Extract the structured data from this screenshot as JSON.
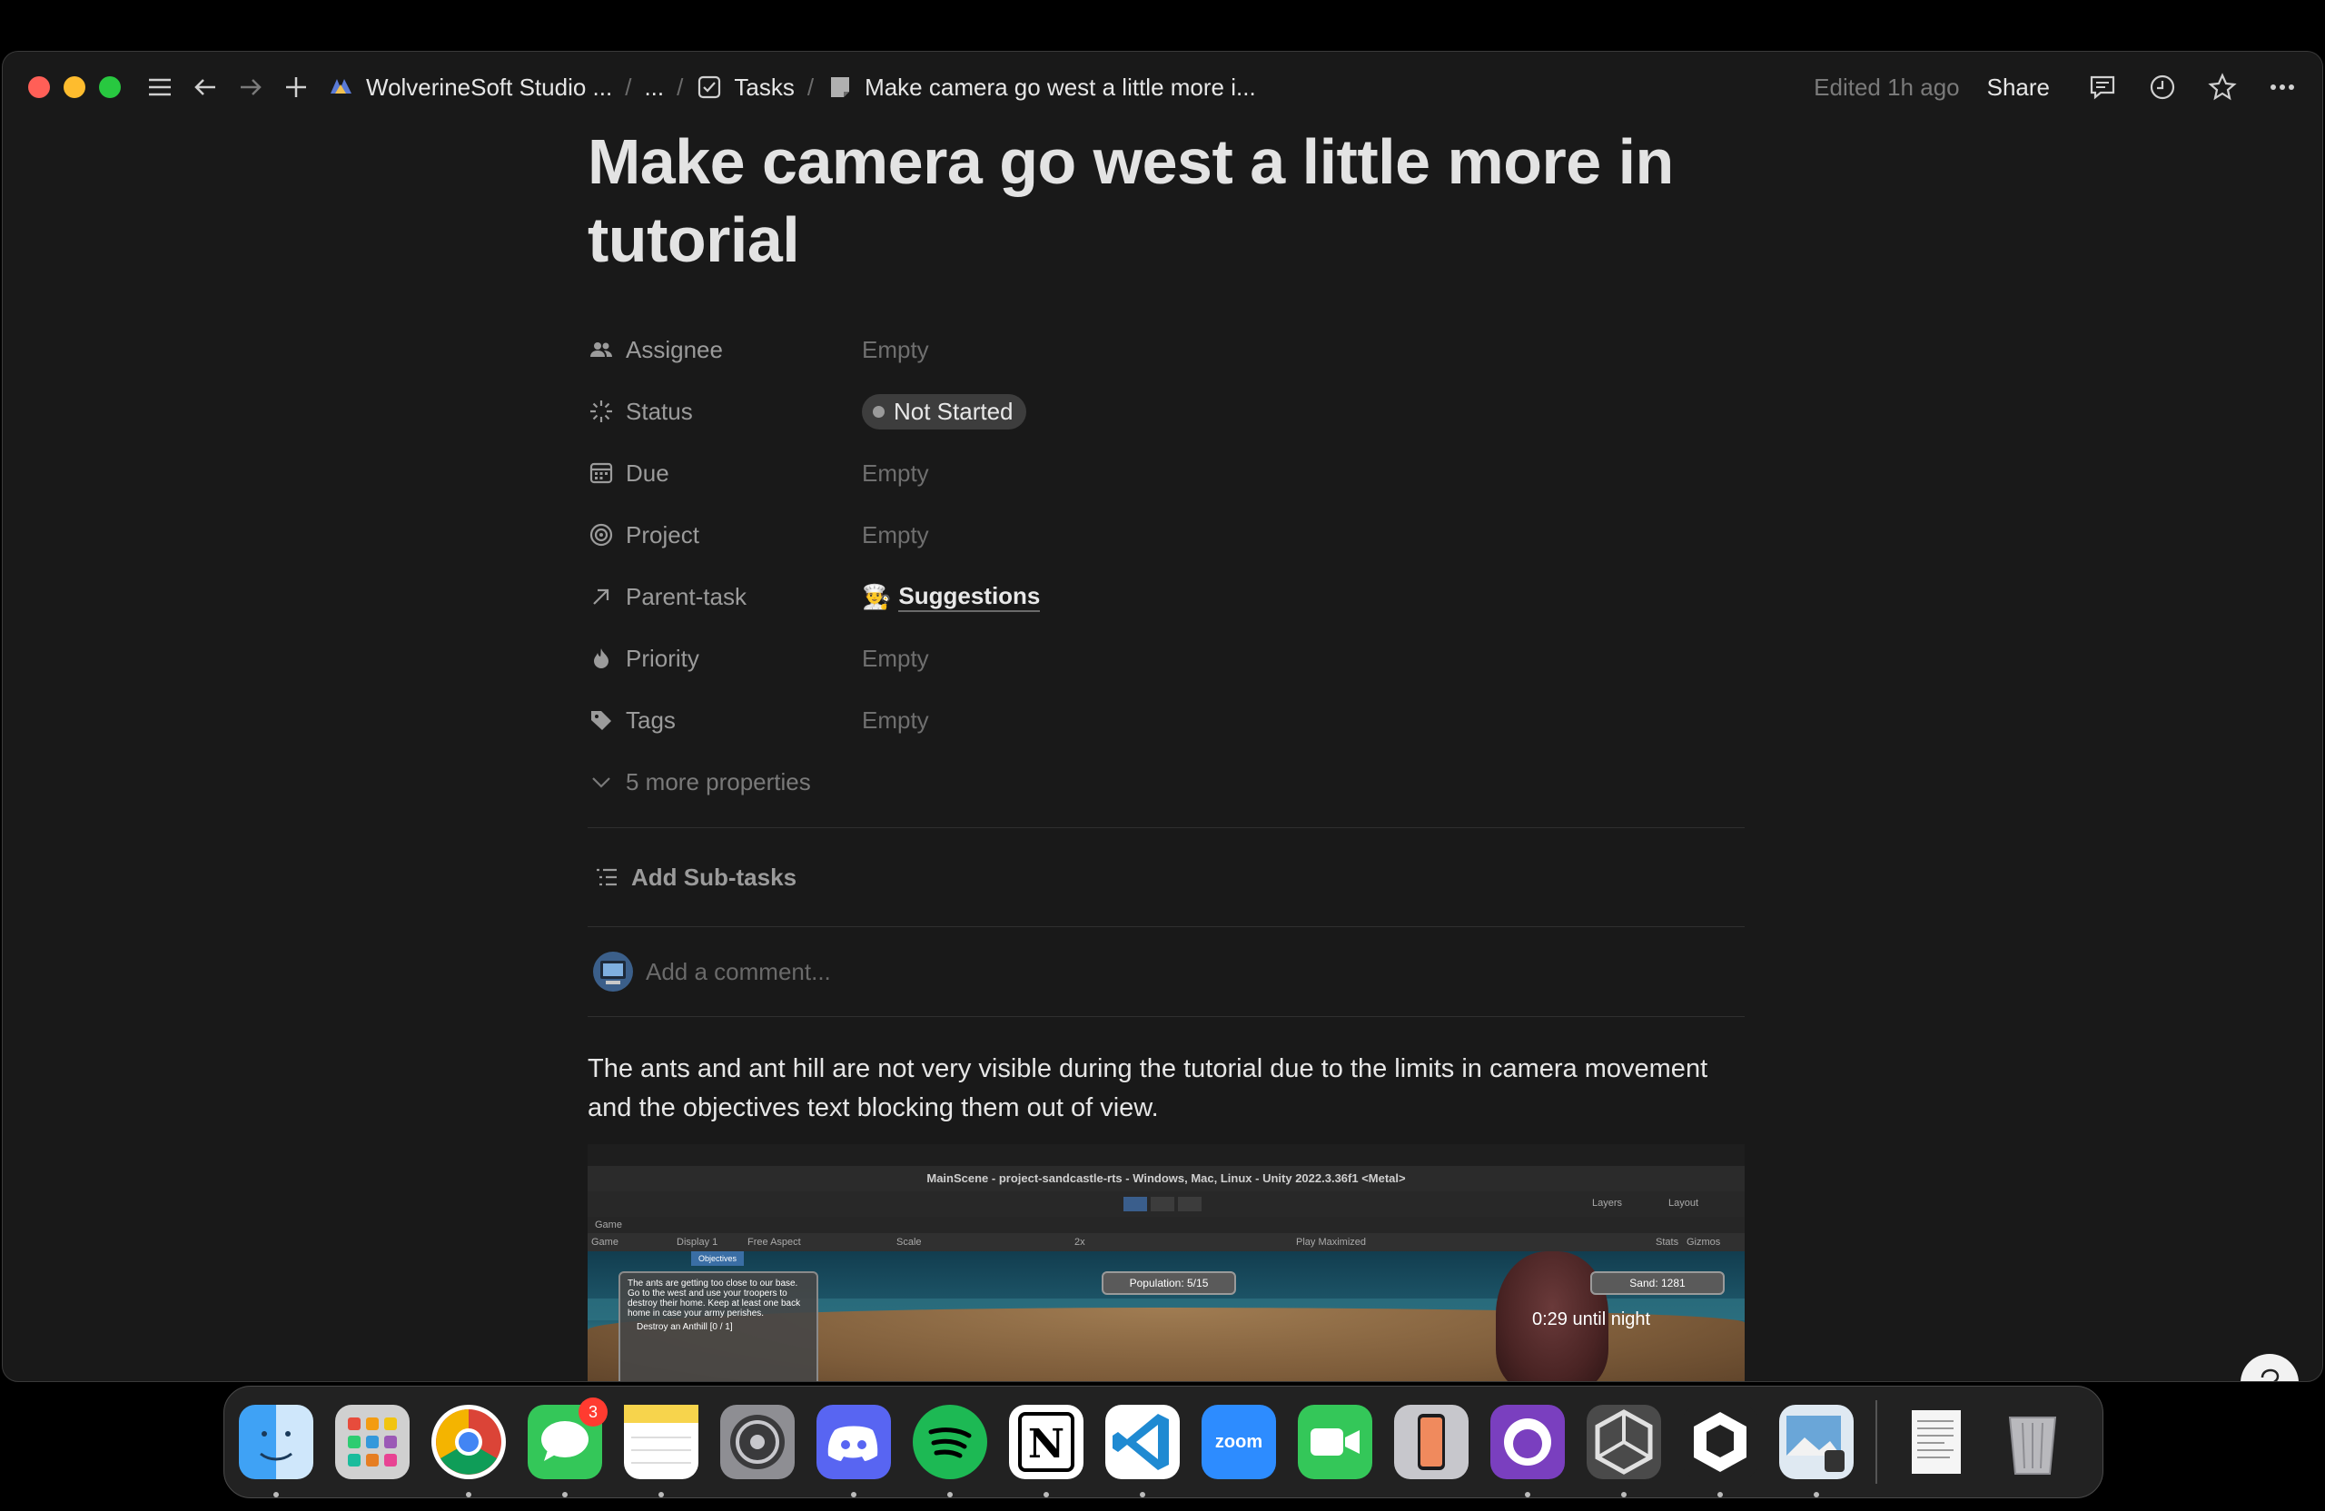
{
  "window": {
    "breadcrumbs": {
      "workspace": "WolverineSoft Studio ...",
      "ellipsis": "...",
      "tasks": "Tasks",
      "page": "Make camera go west a little more i..."
    },
    "edited": "Edited 1h ago",
    "share": "Share"
  },
  "page": {
    "title": "Make camera go west a little more in tutorial",
    "properties": [
      {
        "name": "Assignee",
        "value": "Empty",
        "icon": "people-icon"
      },
      {
        "name": "Status",
        "value": "Not Started",
        "icon": "loading-sun-icon"
      },
      {
        "name": "Due",
        "value": "Empty",
        "icon": "calendar-icon"
      },
      {
        "name": "Project",
        "value": "Empty",
        "icon": "target-icon"
      },
      {
        "name": "Parent-task",
        "value": "Suggestions",
        "value_emoji": "👨‍🍳",
        "icon": "arrow-up-right-icon"
      },
      {
        "name": "Priority",
        "value": "Empty",
        "icon": "flame-icon"
      },
      {
        "name": "Tags",
        "value": "Empty",
        "icon": "tag-icon"
      }
    ],
    "more_properties": "5 more properties",
    "add_subtasks": "Add Sub-tasks",
    "comment_placeholder": "Add a comment...",
    "body": "The ants and ant hill are not very visible during the tutorial due to the limits in camera movement and the objectives text blocking them out of view.",
    "embedded_screenshot": {
      "window_title": "MainScene - project-sandcastle-rts - Windows, Mac, Linux - Unity 2022.3.36f1 <Metal>",
      "game_tab": "Game",
      "options": [
        "Game",
        "Display 1",
        "Free Aspect",
        "Scale",
        "2x",
        "Play Maximized",
        "Stats",
        "Gizmos"
      ],
      "toolbar_right": [
        "Layers",
        "Layout"
      ],
      "objectives_tab": "Objectives",
      "objectives_text": "The ants are getting too close to our base. Go to the west and use your troopers to destroy their home. Keep at least one back home in case your army perishes.",
      "objective_item": "Destroy an Anthill [0 / 1]",
      "population": "Population: 5/15",
      "sand": "Sand: 1281",
      "timer": "0:29 until night"
    }
  },
  "dock": {
    "messages_badge": "3",
    "zoom_label": "zoom",
    "items": [
      "Finder",
      "Launchpad",
      "Chrome",
      "Messages",
      "Notes",
      "System Settings",
      "Discord",
      "Spotify",
      "Notion",
      "VS Code",
      "Zoom",
      "FaceTime",
      "iPhone Mirroring",
      "GitHub Desktop",
      "Unity Hub",
      "Unity",
      "Preview",
      "Document",
      "Trash"
    ]
  },
  "colors": {
    "background": "#191919",
    "text": "#e3e3e3",
    "muted": "#9b9b9b",
    "placeholder": "#6f6f6f"
  }
}
